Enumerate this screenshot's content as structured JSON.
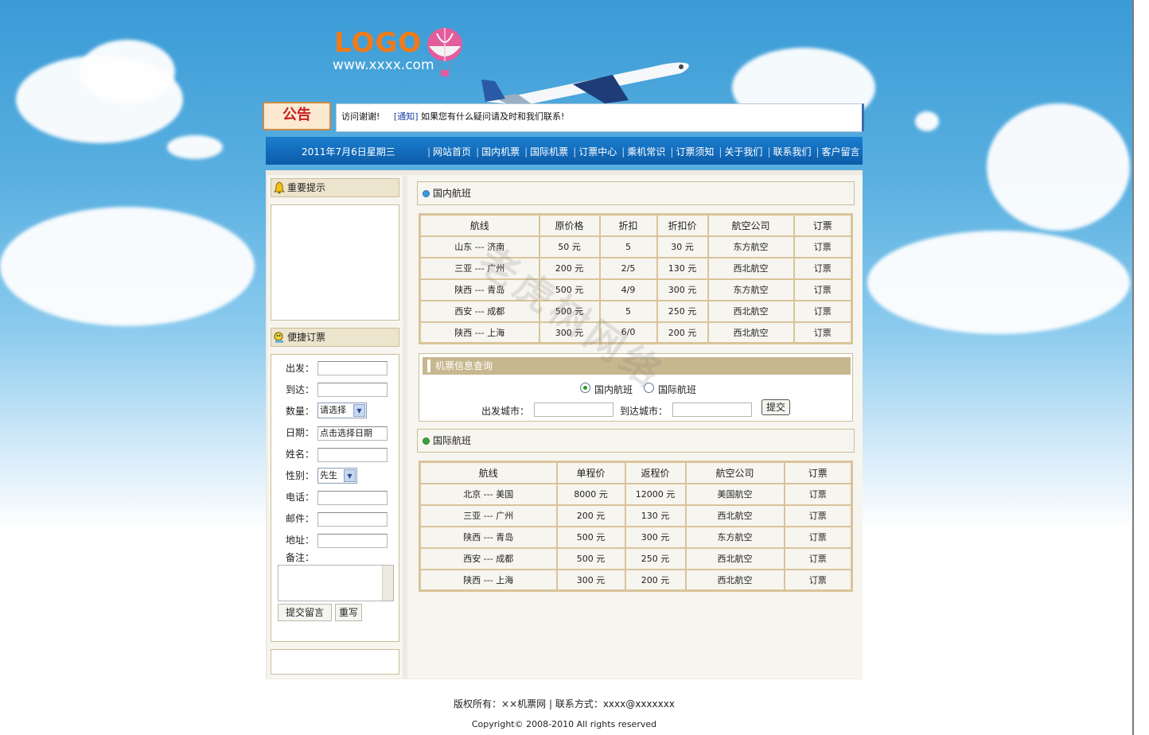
{
  "header": {
    "logo": "LOGO",
    "url": "www.xxxx.com"
  },
  "notice": {
    "badge": "公告",
    "text": "访问谢谢!",
    "tag": "[通知]",
    "message": "如果您有什么疑问请及时和我们联系!"
  },
  "nav": {
    "date": "2011年7月6日星期三",
    "items": [
      "网站首页",
      "国内机票",
      "国际机票",
      "订票中心",
      "乘机常识",
      "订票须知",
      "关于我们",
      "联系我们",
      "客户留言"
    ]
  },
  "sidebar": {
    "tips_title": "重要提示",
    "booking_title": "便捷订票",
    "form": {
      "from": "出发：",
      "to": "到达：",
      "qty": "数量：",
      "qty_value": "请选择",
      "date": "日期：",
      "date_value": "点击选择日期",
      "name": "姓名：",
      "gender": "性别：",
      "gender_value": "先生",
      "phone": "电话：",
      "email": "邮件：",
      "address": "地址：",
      "note": "备注：",
      "submit": "提交留言",
      "reset": "重写"
    }
  },
  "domestic": {
    "title": "国内航班",
    "headers": [
      "航线",
      "原价格",
      "折扣",
      "折扣价",
      "航空公司",
      "订票"
    ],
    "rows": [
      [
        "山东  --- 济南",
        "50 元",
        "5",
        "30 元",
        "东方航空",
        "订票"
      ],
      [
        "三亚  --- 广州",
        "200 元",
        "2/5",
        "130 元",
        "西北航空",
        "订票"
      ],
      [
        "陕西  --- 青岛",
        "500 元",
        "4/9",
        "300 元",
        "东方航空",
        "订票"
      ],
      [
        "西安  --- 成都",
        "500 元",
        "5",
        "250 元",
        "西北航空",
        "订票"
      ],
      [
        "陕西  --- 上海",
        "300 元",
        "6/0",
        "200 元",
        "西北航空",
        "订票"
      ]
    ]
  },
  "query": {
    "title": "机票信息查询",
    "radio_domestic": "国内航班",
    "radio_intl": "国际航班",
    "from_label": "出发城市：",
    "to_label": "到达城市：",
    "submit": "提交"
  },
  "international": {
    "title": "国际航班",
    "headers": [
      "航线",
      "单程价",
      "返程价",
      "航空公司",
      "订票"
    ],
    "rows": [
      [
        "北京  --- 美国",
        "8000 元",
        "12000 元",
        "美国航空",
        "订票"
      ],
      [
        "三亚  --- 广州",
        "200 元",
        "130 元",
        "西北航空",
        "订票"
      ],
      [
        "陕西  --- 青岛",
        "500 元",
        "300 元",
        "东方航空",
        "订票"
      ],
      [
        "西安  --- 成都",
        "500 元",
        "250 元",
        "西北航空",
        "订票"
      ],
      [
        "陕西  --- 上海",
        "300 元",
        "200 元",
        "西北航空",
        "订票"
      ]
    ]
  },
  "footer": {
    "line1": "版权所有：××机票网 | 联系方式：xxxx@xxxxxxx",
    "line2": "Copyright© 2008-2010 All rights reserved"
  },
  "watermark": "老虎树网络"
}
